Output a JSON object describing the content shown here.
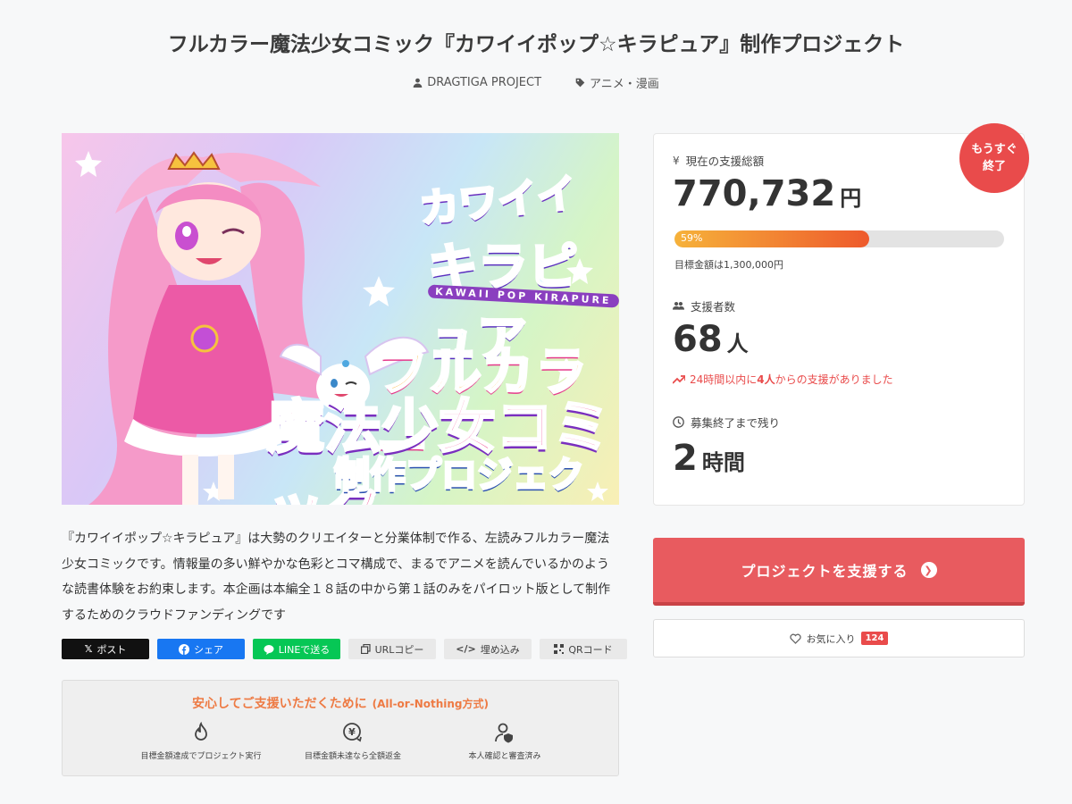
{
  "project": {
    "title": "フルカラー魔法少女コミック『カワイイポップ☆キラピュア』制作プロジェクト",
    "owner": "DRAGTIGA PROJECT",
    "category": "アニメ・漫画",
    "description": "『カワイイポップ☆キラピュア』は大勢のクリエイターと分業体制で作る、左読みフルカラー魔法少女コミックです。情報量の多い鮮やかな色彩とコマ構成で、まるでアニメを読んでいるかのような読書体験をお約束します。本企画は本編全１８話の中から第１話のみをパイロット版として制作するためのクラウドファンディングです"
  },
  "hero": {
    "logo_small": "KAWAII POP KIRAPURE",
    "logo_top": "カワイイ",
    "logo_mid": "キラピュア",
    "line1": "フルカラー",
    "line2": "魔法少女コミック",
    "line3": "制作プロジェクト!"
  },
  "share": {
    "x": "ポスト",
    "facebook": "シェア",
    "line": "LINEで送る",
    "url": "URLコピー",
    "embed": "埋め込み",
    "qr": "QRコード"
  },
  "safety": {
    "heading": "安心してご支援いただくために",
    "subheading": "(All-or-Nothing方式)",
    "items": [
      "目標金額達成でプロジェクト実行",
      "目標金額未達なら全額返金",
      "本人確認と審査済み"
    ]
  },
  "stats": {
    "badge_line1": "もうすぐ",
    "badge_line2": "終了",
    "total_label": "現在の支援総額",
    "total_amount": "770,732",
    "total_unit": "円",
    "progress_percent": 59,
    "progress_label": "59%",
    "goal_text": "目標金額は1,300,000円",
    "backers_label": "支援者数",
    "backers_count": "68",
    "backers_unit": "人",
    "trend_prefix": "24時間以内に",
    "trend_count": "4人",
    "trend_suffix": "からの支援がありました",
    "remaining_label": "募集終了まで残り",
    "remaining_value": "2",
    "remaining_unit": "時間"
  },
  "actions": {
    "support_button": "プロジェクトを支援する",
    "favorite_label": "お気に入り",
    "favorite_count": "124"
  },
  "colors": {
    "accent": "#e85b5f",
    "badge": "#e94b4b",
    "safety_heading": "#ee7a43",
    "line_green": "#06c755",
    "facebook_blue": "#1877f2"
  }
}
